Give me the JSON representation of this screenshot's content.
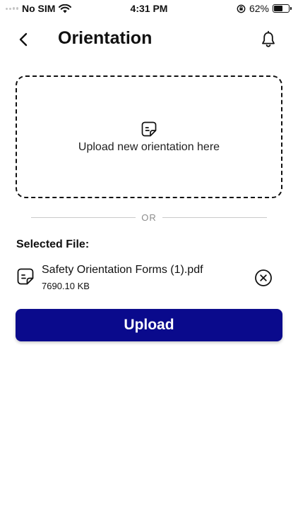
{
  "status_bar": {
    "carrier": "No SIM",
    "time": "4:31 PM",
    "battery_percent": "62%",
    "battery_level": 0.62
  },
  "header": {
    "title": "Orientation",
    "back_icon": "chevron-left-icon",
    "notification_icon": "bell-icon"
  },
  "drop_zone": {
    "icon": "document-icon",
    "text": "Upload new orientation here"
  },
  "divider": {
    "text": "OR"
  },
  "selected_file": {
    "label": "Selected File:",
    "name": "Safety Orientation Forms (1).pdf",
    "size": "7690.10 KB",
    "icon": "document-icon",
    "remove_icon": "close-circle-icon"
  },
  "upload_button": {
    "label": "Upload",
    "color": "#0a0a8c"
  }
}
